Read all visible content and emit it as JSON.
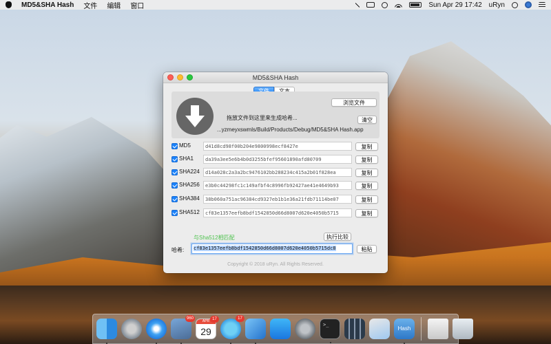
{
  "menubar": {
    "app_name": "MD5&SHA Hash",
    "menus": [
      "文件",
      "编辑",
      "窗口"
    ],
    "clock": "Sun Apr 29  17:42",
    "user": "uRyn"
  },
  "window": {
    "title": "MD5&SHA Hash",
    "tabs": [
      {
        "label": "文件",
        "active": true
      },
      {
        "label": "文本",
        "active": false
      }
    ],
    "browse_label": "浏览文件",
    "drop_hint": "拖放文件到这里来生成哈希...",
    "clear_label": "清空",
    "file_path": "...yzmeyxswmls/Build/Products/Debug/MD5&SHA Hash.app",
    "hashes": [
      {
        "label": "MD5",
        "value": "d41d8cd98f00b204e9800998ecf8427e",
        "copy": "复制"
      },
      {
        "label": "SHA1",
        "value": "da39a3ee5e6b4b0d3255bfef95601890afd80709",
        "copy": "复制"
      },
      {
        "label": "SHA224",
        "value": "d14a028c2a3a2bc9476102bb288234c415a2b01f828ea",
        "copy": "复制"
      },
      {
        "label": "SHA256",
        "value": "e3b0c44298fc1c149afbf4c8996fb92427ae41e4649b93",
        "copy": "复制"
      },
      {
        "label": "SHA384",
        "value": "38b060a751ac96384cd9327eb1b1e36a21fdb71114be07",
        "copy": "复制"
      },
      {
        "label": "SHA512",
        "value": "cf83e1357eefb8bdf1542850d66d8007d620e4050b5715",
        "copy": "复制"
      }
    ],
    "match_text": "与Sha512相匹配",
    "compare_button": "执行比较",
    "compare_label": "哈希:",
    "compare_value": "cf83e1357eefb8bdf1542850d66d8007d620e4050b5715dc8",
    "paste_label": "粘贴",
    "copyright": "Copyright © 2018 uRyn. All Rights Reserved."
  },
  "dock": {
    "photos_badge": "960",
    "calendar_month": "APR",
    "calendar_day": "29",
    "calendar_badge": "17",
    "messages_badge": "17",
    "hash_app_label": "Hash"
  }
}
